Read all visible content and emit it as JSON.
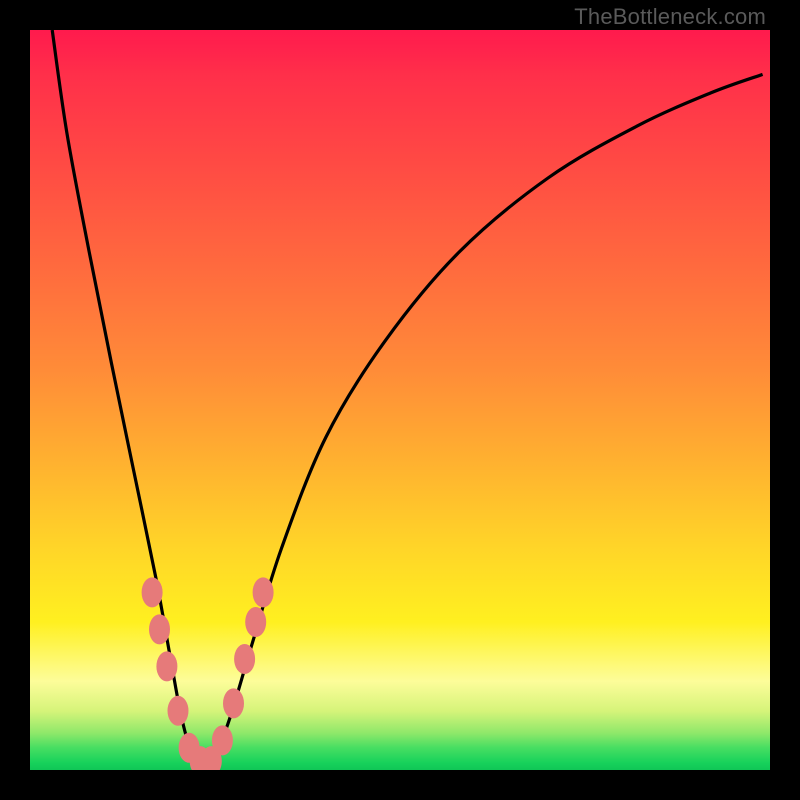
{
  "watermark": "TheBottleneck.com",
  "chart_data": {
    "type": "line",
    "title": "",
    "xlabel": "",
    "ylabel": "",
    "xlim": [
      0,
      100
    ],
    "ylim": [
      0,
      100
    ],
    "series": [
      {
        "name": "bottleneck-curve",
        "x": [
          3,
          5,
          8,
          11,
          14,
          17,
          19,
          20.5,
          22,
          23.5,
          25,
          27,
          30,
          34,
          40,
          48,
          58,
          70,
          82,
          92,
          99
        ],
        "y": [
          100,
          86,
          70,
          55,
          40.5,
          26,
          15,
          7,
          2,
          1,
          2,
          7,
          17,
          30,
          45,
          58,
          70,
          80,
          87,
          91.5,
          94
        ]
      }
    ],
    "markers": {
      "name": "highlight-region",
      "color": "#e67a7a",
      "points": [
        {
          "x": 16.5,
          "y": 24
        },
        {
          "x": 17.5,
          "y": 19
        },
        {
          "x": 18.5,
          "y": 14
        },
        {
          "x": 20.0,
          "y": 8
        },
        {
          "x": 21.5,
          "y": 3
        },
        {
          "x": 23.0,
          "y": 1.2
        },
        {
          "x": 24.5,
          "y": 1.2
        },
        {
          "x": 26.0,
          "y": 4
        },
        {
          "x": 27.5,
          "y": 9
        },
        {
          "x": 29.0,
          "y": 15
        },
        {
          "x": 30.5,
          "y": 20
        },
        {
          "x": 31.5,
          "y": 24
        }
      ]
    },
    "colors": {
      "gradient_top": "#ff1a4d",
      "gradient_mid": "#ffd528",
      "gradient_bottom": "#10c656",
      "curve": "#000000",
      "marker": "#e67a7a",
      "frame": "#000000"
    }
  }
}
